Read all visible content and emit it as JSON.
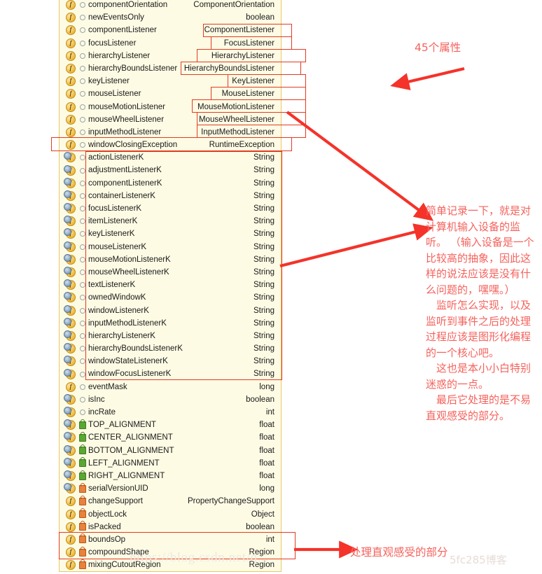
{
  "panel": {
    "rows": [
      {
        "name": "componentOrientation",
        "type": "ComponentOrientation",
        "icon": "field-icon",
        "badge": "package-badge"
      },
      {
        "name": "newEventsOnly",
        "type": "boolean",
        "icon": "field-icon",
        "badge": "package-badge"
      },
      {
        "name": "componentListener",
        "type": "ComponentListener",
        "icon": "field-icon",
        "badge": "package-badge"
      },
      {
        "name": "focusListener",
        "type": "FocusListener",
        "icon": "field-icon",
        "badge": "package-badge"
      },
      {
        "name": "hierarchyListener",
        "type": "HierarchyListener",
        "icon": "field-icon",
        "badge": "package-badge"
      },
      {
        "name": "hierarchyBoundsListener",
        "type": "HierarchyBoundsListener",
        "icon": "field-icon",
        "badge": "package-badge"
      },
      {
        "name": "keyListener",
        "type": "KeyListener",
        "icon": "field-icon",
        "badge": "package-badge"
      },
      {
        "name": "mouseListener",
        "type": "MouseListener",
        "icon": "field-icon",
        "badge": "package-badge"
      },
      {
        "name": "mouseMotionListener",
        "type": "MouseMotionListener",
        "icon": "field-icon",
        "badge": "package-badge"
      },
      {
        "name": "mouseWheelListener",
        "type": "MouseWheelListener",
        "icon": "field-icon",
        "badge": "package-badge"
      },
      {
        "name": "inputMethodListener",
        "type": "InputMethodListener",
        "icon": "field-icon",
        "badge": "package-badge"
      },
      {
        "name": "windowClosingException",
        "type": "RuntimeException",
        "icon": "field-icon",
        "badge": "package-badge"
      },
      {
        "name": "actionListenerK",
        "type": "String",
        "icon": "static-field-icon",
        "badge": "package-badge"
      },
      {
        "name": "adjustmentListenerK",
        "type": "String",
        "icon": "static-field-icon",
        "badge": "package-badge"
      },
      {
        "name": "componentListenerK",
        "type": "String",
        "icon": "static-field-icon",
        "badge": "package-badge"
      },
      {
        "name": "containerListenerK",
        "type": "String",
        "icon": "static-field-icon",
        "badge": "package-badge"
      },
      {
        "name": "focusListenerK",
        "type": "String",
        "icon": "static-field-icon",
        "badge": "package-badge"
      },
      {
        "name": "itemListenerK",
        "type": "String",
        "icon": "static-field-icon",
        "badge": "package-badge"
      },
      {
        "name": "keyListenerK",
        "type": "String",
        "icon": "static-field-icon",
        "badge": "package-badge"
      },
      {
        "name": "mouseListenerK",
        "type": "String",
        "icon": "static-field-icon",
        "badge": "package-badge"
      },
      {
        "name": "mouseMotionListenerK",
        "type": "String",
        "icon": "static-field-icon",
        "badge": "package-badge"
      },
      {
        "name": "mouseWheelListenerK",
        "type": "String",
        "icon": "static-field-icon",
        "badge": "package-badge"
      },
      {
        "name": "textListenerK",
        "type": "String",
        "icon": "static-field-icon",
        "badge": "package-badge"
      },
      {
        "name": "ownedWindowK",
        "type": "String",
        "icon": "static-field-icon",
        "badge": "package-badge"
      },
      {
        "name": "windowListenerK",
        "type": "String",
        "icon": "static-field-icon",
        "badge": "package-badge"
      },
      {
        "name": "inputMethodListenerK",
        "type": "String",
        "icon": "static-field-icon",
        "badge": "package-badge"
      },
      {
        "name": "hierarchyListenerK",
        "type": "String",
        "icon": "static-field-icon",
        "badge": "package-badge"
      },
      {
        "name": "hierarchyBoundsListenerK",
        "type": "String",
        "icon": "static-field-icon",
        "badge": "package-badge"
      },
      {
        "name": "windowStateListenerK",
        "type": "String",
        "icon": "static-field-icon",
        "badge": "package-badge"
      },
      {
        "name": "windowFocusListenerK",
        "type": "String",
        "icon": "static-field-icon",
        "badge": "package-badge"
      },
      {
        "name": "eventMask",
        "type": "long",
        "icon": "field-icon",
        "badge": "package-badge"
      },
      {
        "name": "isInc",
        "type": "boolean",
        "icon": "static-field-icon",
        "badge": "package-badge"
      },
      {
        "name": "incRate",
        "type": "int",
        "icon": "static-field-icon",
        "badge": "package-badge"
      },
      {
        "name": "TOP_ALIGNMENT",
        "type": "float",
        "icon": "static-field-icon",
        "badge": "public-lock-badge"
      },
      {
        "name": "CENTER_ALIGNMENT",
        "type": "float",
        "icon": "static-field-icon",
        "badge": "public-lock-badge"
      },
      {
        "name": "BOTTOM_ALIGNMENT",
        "type": "float",
        "icon": "static-field-icon",
        "badge": "public-lock-badge"
      },
      {
        "name": "LEFT_ALIGNMENT",
        "type": "float",
        "icon": "static-field-icon",
        "badge": "public-lock-badge"
      },
      {
        "name": "RIGHT_ALIGNMENT",
        "type": "float",
        "icon": "static-field-icon",
        "badge": "public-lock-badge"
      },
      {
        "name": "serialVersionUID",
        "type": "long",
        "icon": "static-field-icon",
        "badge": "private-lock-badge"
      },
      {
        "name": "changeSupport",
        "type": "PropertyChangeSupport",
        "icon": "field-icon",
        "badge": "private-lock-badge"
      },
      {
        "name": "objectLock",
        "type": "Object",
        "icon": "field-icon",
        "badge": "private-lock-badge"
      },
      {
        "name": "isPacked",
        "type": "boolean",
        "icon": "field-icon",
        "badge": "private-lock-badge"
      },
      {
        "name": "boundsOp",
        "type": "int",
        "icon": "field-icon",
        "badge": "private-lock-badge"
      },
      {
        "name": "compoundShape",
        "type": "Region",
        "icon": "field-icon",
        "badge": "private-lock-badge"
      },
      {
        "name": "mixingCutoutRegion",
        "type": "Region",
        "icon": "field-icon",
        "badge": "private-lock-badge"
      }
    ]
  },
  "annotations": {
    "count_label": "45个属性",
    "main_text": "简单记录一下，就是对计算机输入设备的监听。 （输入设备是一个比较高的抽象，因此这样的说法应该是没有什么问题的，嘿嘿。）\n　监听怎么实现，以及监听到事件之后的处理过程应该是图形化编程的一个核心吧。\n　这也是本小小白特别迷惑的一点。\n　最后它处理的是不易直观感受的部分。",
    "bottom_label": "处理直观感受的部分"
  },
  "watermark": {
    "url_text": "https://blog.csdn.net/q...",
    "site_text": "5fc285博客"
  },
  "colors": {
    "panel_bg": "#fdfbe4",
    "panel_border": "#e8c96a",
    "annotation_red": "#f4625c",
    "highlight_red": "#e23b22"
  }
}
